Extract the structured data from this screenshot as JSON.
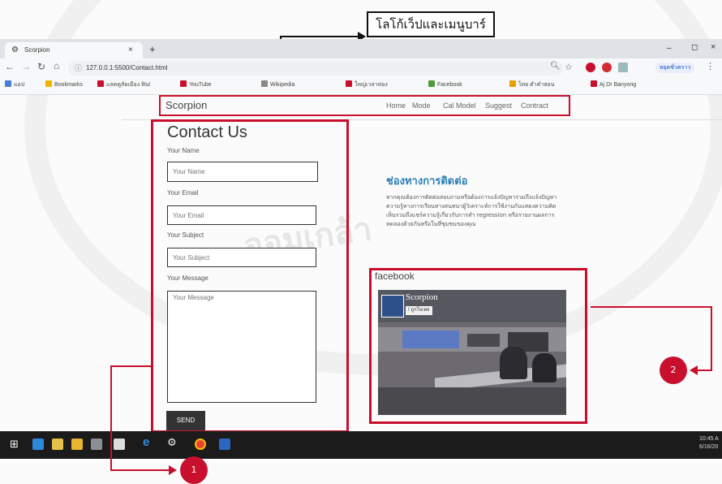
{
  "annotation": {
    "label": "โลโก้เว็ปและเมนูบาร์",
    "callout_1": "1",
    "callout_2": "2"
  },
  "browser": {
    "tab_title": "Scorpion",
    "tab_close": "×",
    "new_tab": "+",
    "url": "127.0.0.1:5500/Contact.html",
    "profile_button": "หยุดชั่วคราว",
    "bookmarks": [
      "แอป",
      "Bookmarks",
      "แลคดูลัยเมือง.ฟิน!",
      "YouTube",
      "Wikipedia",
      "ใหญ่เวลาท่อง",
      "Facebook",
      "ไทย ตำคำสอน",
      "Aj Dr Banyong"
    ]
  },
  "site": {
    "logo": "Scorpion",
    "nav": [
      "Home",
      "Mode",
      "Cal Model",
      "Suggest",
      "Contract"
    ]
  },
  "contact": {
    "title": "Contact Us",
    "name_label": "Your Name",
    "name_placeholder": "Your Name",
    "email_label": "Your Email",
    "email_placeholder": "Your Email",
    "subject_label": "Your Subject",
    "subject_placeholder": "Your Subject",
    "message_label": "Your Message",
    "message_placeholder": "Your Message",
    "send_button": "SEND"
  },
  "channel": {
    "heading": "ช่องทางการติดต่อ",
    "body": "หากคุณต้องการติดต่อสอบถามหรือต้องการแจ้งปัญหาร่วมถึงแจ้งปัญหาความรู้ทางการเรียนทางสนทนาผู้วิเคราะห์การใช้งานกับแสดงความคิดเห็นรวมถึงแชร์ความรู้เกี่ยวกับการทำ regression หรือรายงานผลการทดลองด้วยกันหรือในที่ชุมชนของคุณ"
  },
  "facebook": {
    "title": "facebook",
    "page_name": "Scorpion",
    "like_button": "ถูกใจเพจ"
  },
  "taskbar": {
    "time": "10:45 A",
    "date": "6/16/20"
  }
}
